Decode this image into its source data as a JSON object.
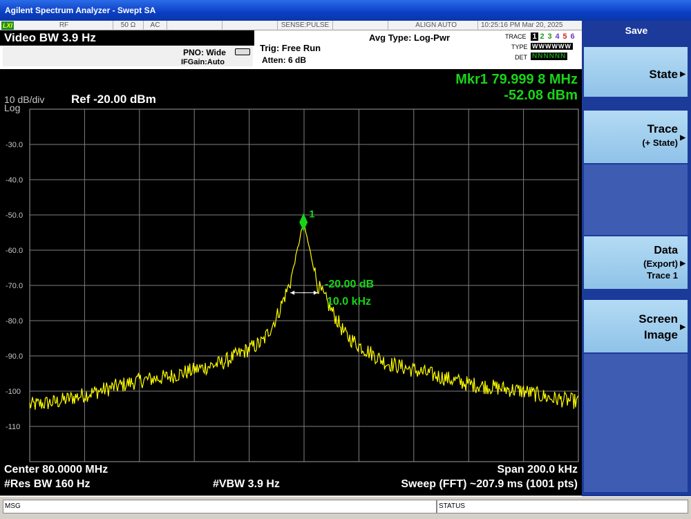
{
  "window": {
    "title": "Agilent Spectrum Analyzer - Swept SA"
  },
  "status": {
    "logo": "LXI",
    "rf": "RF",
    "impedance": "50 Ω",
    "coupling": "AC",
    "sense": "SENSE:PULSE",
    "align": "ALIGN AUTO",
    "time": "10:25:16 PM Mar 20, 2025"
  },
  "header": {
    "vbw_title": "Video BW 3.9 Hz",
    "pno": "PNO: Wide",
    "ifgain": "IFGain:Auto",
    "trig": "Trig: Free Run",
    "atten": "Atten: 6 dB",
    "avg_type": "Avg Type: Log-Pwr",
    "trace_label": "TRACE",
    "type_label": "TYPE",
    "det_label": "DET",
    "trace_numbers": [
      "1",
      "2",
      "3",
      "4",
      "5",
      "6"
    ],
    "trace_colors": [
      "#000000",
      "#1a9a1a",
      "#1a9a1a",
      "#6a3ad0",
      "#d02020",
      "#6a3ad0"
    ],
    "type_row": "WWWWWW",
    "det_row": "NNNNNN"
  },
  "marker": {
    "freq": "Mkr1 79.999 8 MHz",
    "amp": "-52.08 dBm",
    "label": "1",
    "delta_db": "-20.00 dB",
    "delta_bw": "10.0 kHz"
  },
  "scale": {
    "per_div": "10 dB/div",
    "ref": "Ref -20.00 dBm",
    "mode": "Log"
  },
  "footer": {
    "center": "Center 80.0000 MHz",
    "span": "Span 200.0 kHz",
    "rbw": "#Res BW 160 Hz",
    "vbw": "#VBW 3.9 Hz",
    "sweep": "Sweep (FFT)  ~207.9 ms (1001 pts)"
  },
  "softkeys": {
    "header": "Save",
    "state": "State",
    "trace": "Trace",
    "trace_sub": "(+ State)",
    "data": "Data",
    "data_sub1": "(Export)",
    "data_sub2": "Trace 1",
    "screen1": "Screen",
    "screen2": "Image"
  },
  "bottom": {
    "msg": "MSG",
    "status": "STATUS"
  },
  "colors": {
    "trace": "#ffff00",
    "marker": "#18d418",
    "grid": "#808080",
    "softkey_bg": "#1c3a9a"
  },
  "chart_data": {
    "type": "line",
    "title": "",
    "xlabel": "",
    "ylabel": "",
    "xlim": [
      79.9,
      80.1
    ],
    "ylim": [
      -120,
      -20
    ],
    "grid": true,
    "y_ticks": [
      "-30.0",
      "-40.0",
      "-50.0",
      "-60.0",
      "-70.0",
      "-80.0",
      "-90.0",
      "-100",
      "-110"
    ],
    "series": [
      {
        "x": [
          79.9,
          79.91,
          79.92,
          79.93,
          79.94,
          79.95,
          79.96,
          79.97,
          79.98,
          79.985,
          79.99,
          79.995,
          79.9998,
          80.005,
          80.01,
          80.015,
          80.02,
          80.03,
          80.04,
          80.05,
          80.06,
          80.07,
          80.08,
          80.09,
          80.1
        ],
        "values": [
          -104,
          -103,
          -101,
          -99,
          -97,
          -96,
          -94,
          -92,
          -88,
          -86,
          -79,
          -69,
          -52,
          -70,
          -77,
          -84,
          -87,
          -92,
          -94,
          -96,
          -98,
          -99,
          -100,
          -102,
          -103
        ]
      }
    ]
  }
}
